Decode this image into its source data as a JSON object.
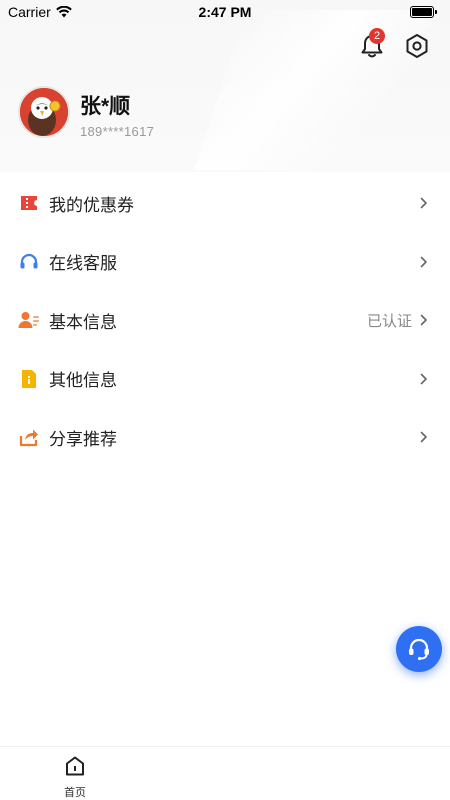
{
  "status_bar": {
    "carrier": "Carrier",
    "time": "2:47 PM"
  },
  "header": {
    "notification_count": "2"
  },
  "profile": {
    "name": "张*顺",
    "phone": "189****1617"
  },
  "menu": {
    "items": [
      {
        "label": "我的优惠券",
        "icon": "coupon-icon",
        "extra": ""
      },
      {
        "label": "在线客服",
        "icon": "headset-icon",
        "extra": ""
      },
      {
        "label": "基本信息",
        "icon": "user-info-icon",
        "extra": "已认证"
      },
      {
        "label": "其他信息",
        "icon": "info-doc-icon",
        "extra": ""
      },
      {
        "label": "分享推荐",
        "icon": "share-icon",
        "extra": ""
      }
    ]
  },
  "tabbar": {
    "home_label": "首页"
  },
  "colors": {
    "accent_blue": "#2f6ff2",
    "badge_red": "#e2352f",
    "coupon_red": "#e8463b",
    "headset_blue": "#3f7df0",
    "user_orange": "#f0772f",
    "info_yellow": "#f4b400",
    "share_orange": "#f0772f"
  }
}
